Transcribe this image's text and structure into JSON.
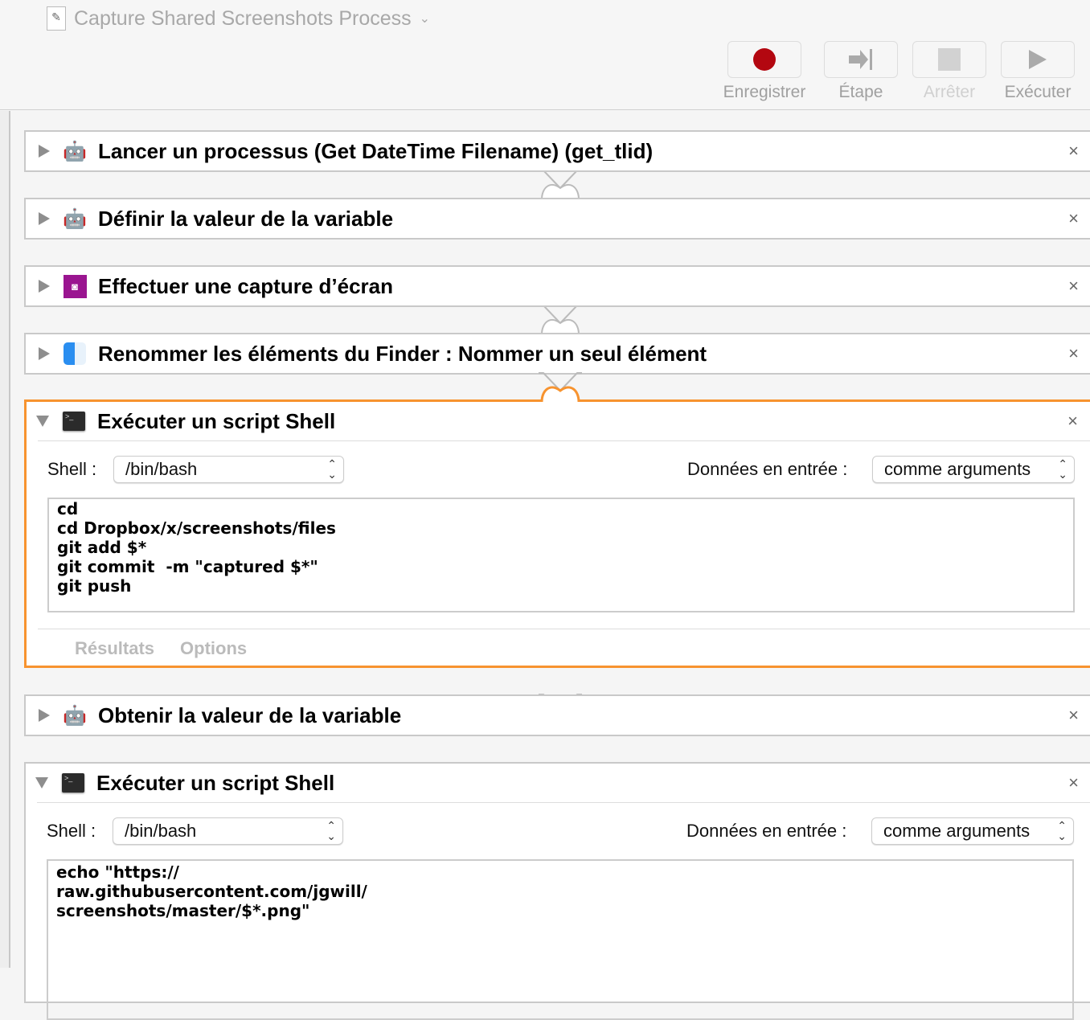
{
  "window": {
    "title": "Capture Shared Screenshots Process",
    "doc_icon": "workflow-file-icon"
  },
  "toolbar": {
    "record": {
      "label": "Enregistrer",
      "icon": "record-icon",
      "color": "#b30710"
    },
    "step": {
      "label": "Étape",
      "icon": "step-icon"
    },
    "stop": {
      "label": "Arrêter",
      "icon": "stop-icon",
      "disabled": true
    },
    "run": {
      "label": "Exécuter",
      "icon": "play-icon"
    }
  },
  "accent": "#f7932f",
  "actions": [
    {
      "title": "Lancer un processus (Get DateTime Filename) (get_tlid)",
      "icon": "automator-robot-icon",
      "expanded": false
    },
    {
      "title": "Définir la valeur de la variable",
      "icon": "automator-robot-icon",
      "expanded": false
    },
    {
      "title": "Effectuer une capture d’écran",
      "icon": "screenshot-icon",
      "expanded": false
    },
    {
      "title": "Renommer les éléments du Finder : Nommer un seul élément",
      "icon": "finder-icon",
      "expanded": false
    },
    {
      "title": "Exécuter un script Shell",
      "icon": "terminal-icon",
      "expanded": true,
      "selected": true,
      "shell_label": "Shell :",
      "shell": "/bin/bash",
      "input_label": "Données en entrée :",
      "input": "comme arguments",
      "script": "cd\ncd Dropbox/x/screenshots/files\ngit add $*\ngit commit  -m \"captured $*\"\ngit push",
      "tabs": [
        "Résultats",
        "Options"
      ]
    },
    {
      "title": "Obtenir la valeur de la variable",
      "icon": "automator-robot-icon",
      "expanded": false
    },
    {
      "title": "Exécuter un script Shell",
      "icon": "terminal-icon",
      "expanded": true,
      "shell_label": "Shell :",
      "shell": "/bin/bash",
      "input_label": "Données en entrée :",
      "input": "comme arguments",
      "script": "echo \"https://\nraw.githubusercontent.com/jgwill/\nscreenshots/master/$*.png\""
    }
  ],
  "close_glyph": "×"
}
